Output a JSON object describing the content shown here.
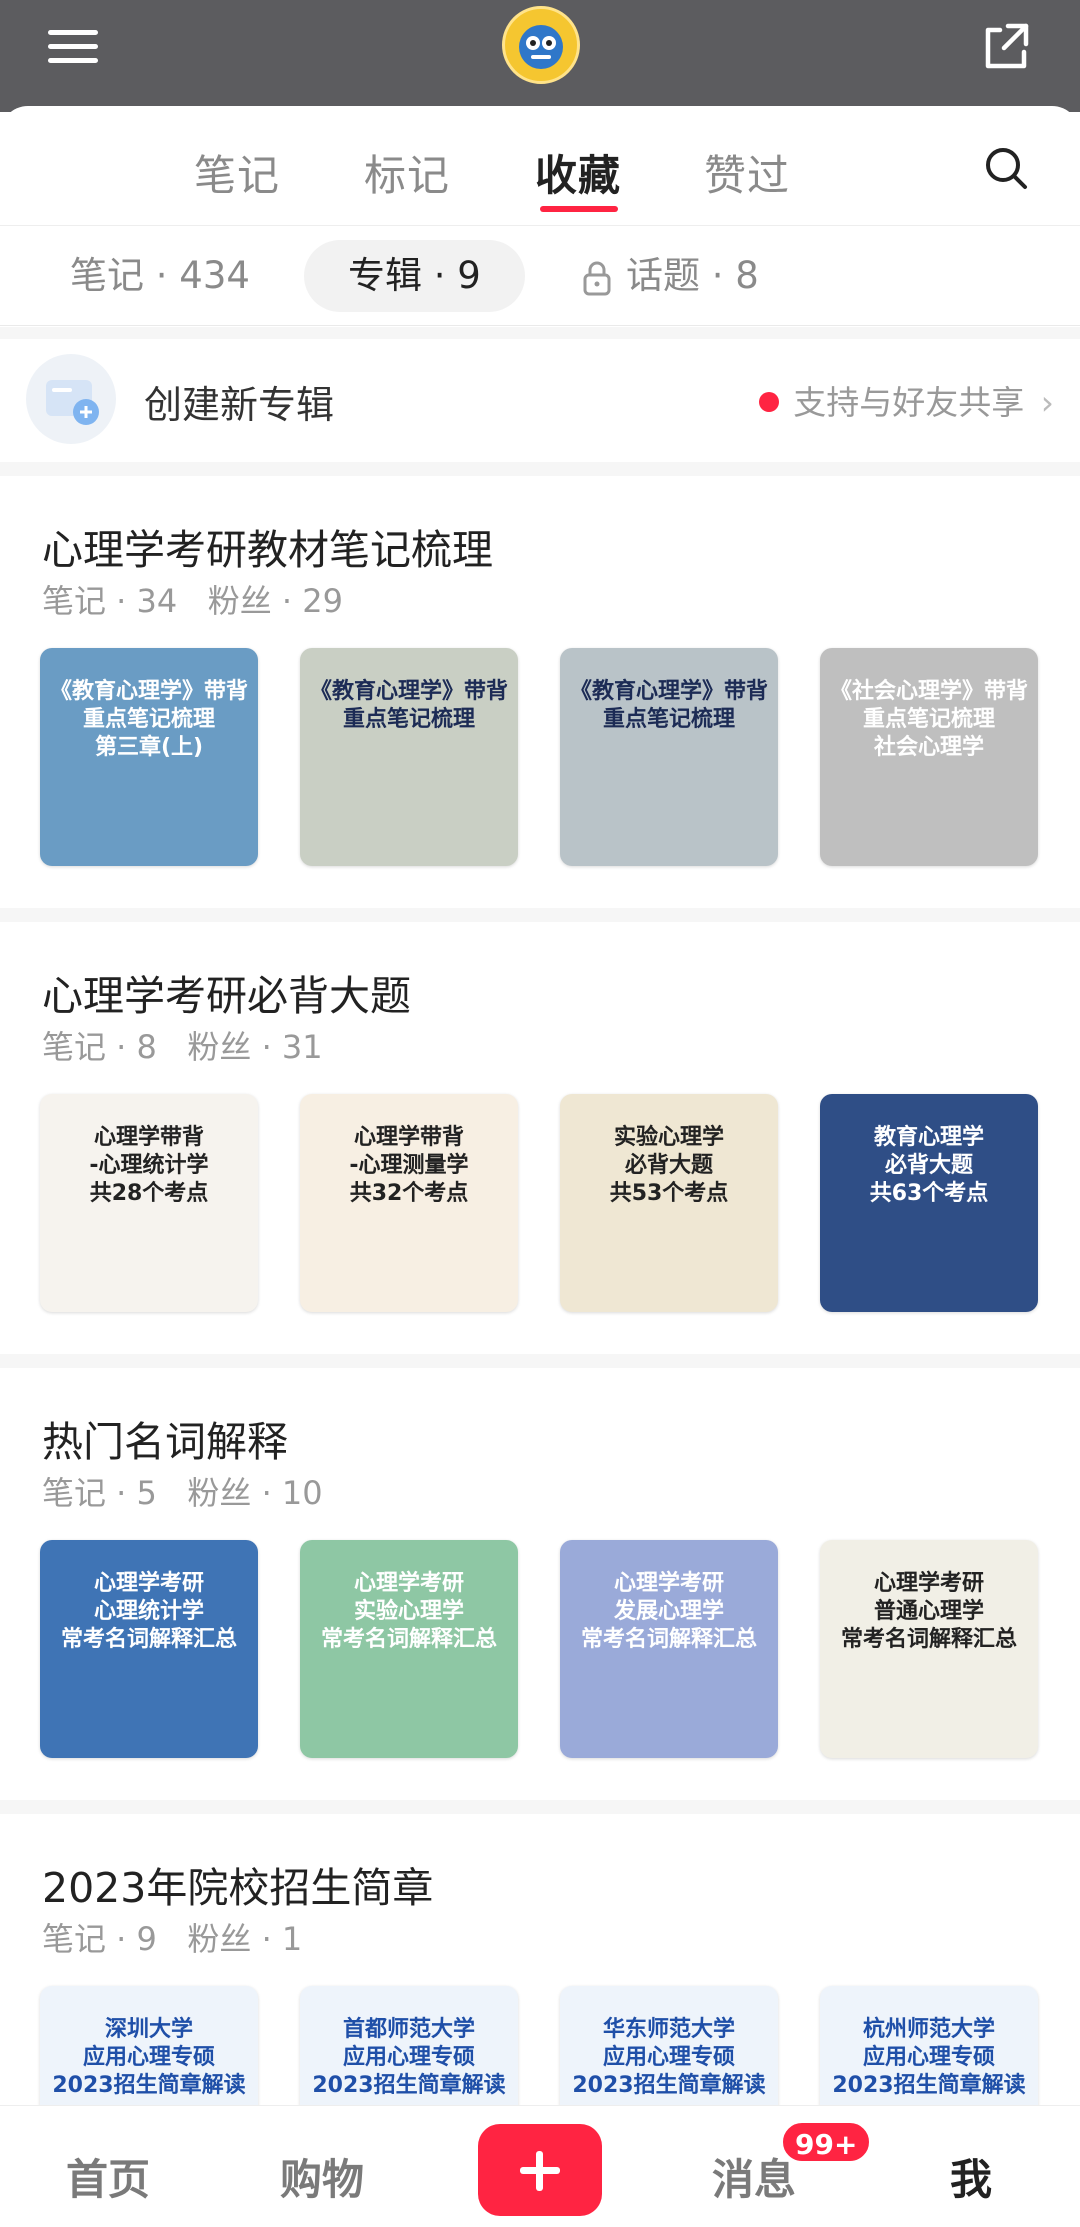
{
  "header": {
    "avatar_label": "avatar"
  },
  "tabs": [
    {
      "label": "笔记"
    },
    {
      "label": "标记"
    },
    {
      "label": "收藏"
    },
    {
      "label": "赞过"
    }
  ],
  "subtabs": [
    {
      "label": "笔记 · 434"
    },
    {
      "label": "专辑 · 9"
    },
    {
      "label": "话题 · 8"
    }
  ],
  "create": {
    "label": "创建新专辑",
    "hint": "支持与好友共享"
  },
  "albums": [
    {
      "title": "心理学考研教材笔记梳理",
      "meta": "笔记 · 34   粉丝 · 29",
      "thumbs": [
        {
          "text": "《教育心理学》带背\n重点笔记梳理\n第三章(上)",
          "bg": "#6a9cc4",
          "fg": "#ffffff"
        },
        {
          "text": "《教育心理学》带背\n重点笔记梳理",
          "bg": "#c9cfc4",
          "fg": "#1c2b55"
        },
        {
          "text": "《教育心理学》带背\n重点笔记梳理",
          "bg": "#b9c3c8",
          "fg": "#1c2b55"
        },
        {
          "text": "《社会心理学》带背\n重点笔记梳理\n社会心理学",
          "bg": "#bfbfbf",
          "fg": "#ffffff"
        }
      ]
    },
    {
      "title": "心理学考研必背大题",
      "meta": "笔记 · 8   粉丝 · 31",
      "thumbs": [
        {
          "text": "心理学带背\n-心理统计学\n共28个考点",
          "bg": "#f6f3ee",
          "fg": "#222222"
        },
        {
          "text": "心理学带背\n-心理测量学\n共32个考点",
          "bg": "#f7efe3",
          "fg": "#222222"
        },
        {
          "text": "实验心理学\n必背大题\n共53个考点",
          "bg": "#efe7d3",
          "fg": "#222222"
        },
        {
          "text": "教育心理学\n必背大题\n共63个考点",
          "bg": "#2f4e86",
          "fg": "#ffffff"
        }
      ]
    },
    {
      "title": "热门名词解释",
      "meta": "笔记 · 5   粉丝 · 10",
      "thumbs": [
        {
          "text": "心理学考研\n心理统计学\n常考名词解释汇总",
          "bg": "#3f74b5",
          "fg": "#ffffff"
        },
        {
          "text": "心理学考研\n实验心理学\n常考名词解释汇总",
          "bg": "#8ec7a4",
          "fg": "#ffffff"
        },
        {
          "text": "心理学考研\n发展心理学\n常考名词解释汇总",
          "bg": "#9aaad9",
          "fg": "#ffffff"
        },
        {
          "text": "心理学考研\n普通心理学\n常考名词解释汇总",
          "bg": "#f1efe6",
          "fg": "#222222"
        }
      ]
    },
    {
      "title": "2023年院校招生简章",
      "meta": "笔记 · 9   粉丝 · 1",
      "thumbs": [
        {
          "text": "深圳大学\n应用心理专硕\n2023招生简章解读",
          "bg": "#eef4fb",
          "fg": "#1f4fa8"
        },
        {
          "text": "首都师范大学\n应用心理专硕\n2023招生简章解读",
          "bg": "#eef4fb",
          "fg": "#1f4fa8"
        },
        {
          "text": "华东师范大学\n应用心理专硕\n2023招生简章解读",
          "bg": "#eef4fb",
          "fg": "#1f4fa8"
        },
        {
          "text": "杭州师范大学\n应用心理专硕\n2023招生简章解读",
          "bg": "#eef4fb",
          "fg": "#1f4fa8"
        }
      ]
    }
  ],
  "bottom_nav": [
    {
      "label": "首页"
    },
    {
      "label": "购物"
    },
    {
      "label": "消息"
    },
    {
      "label": "我"
    }
  ],
  "badge": "99+",
  "colors": {
    "accent": "#ff2442",
    "topbar": "#5c5c5f"
  }
}
